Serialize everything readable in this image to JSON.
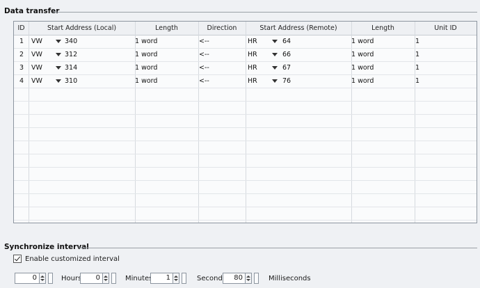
{
  "data_transfer": {
    "title": "Data transfer",
    "columns": [
      "ID",
      "Start Address (Local)",
      "Length",
      "Direction",
      "Start Address (Remote)",
      "Length",
      "Unit ID"
    ],
    "rows": [
      {
        "id": "1",
        "local_area": "VW",
        "local_addr": "340",
        "local_len": "1 word",
        "direction": "<--",
        "remote_area": "HR",
        "remote_addr": "64",
        "remote_len": "1 word",
        "unit_id": "1"
      },
      {
        "id": "2",
        "local_area": "VW",
        "local_addr": "312",
        "local_len": "1 word",
        "direction": "<--",
        "remote_area": "HR",
        "remote_addr": "66",
        "remote_len": "1 word",
        "unit_id": "1"
      },
      {
        "id": "3",
        "local_area": "VW",
        "local_addr": "314",
        "local_len": "1 word",
        "direction": "<--",
        "remote_area": "HR",
        "remote_addr": "67",
        "remote_len": "1 word",
        "unit_id": "1"
      },
      {
        "id": "4",
        "local_area": "VW",
        "local_addr": "310",
        "local_len": "1 word",
        "direction": "<--",
        "remote_area": "HR",
        "remote_addr": "76",
        "remote_len": "1 word",
        "unit_id": "1"
      }
    ]
  },
  "sync": {
    "title": "Synchronize interval",
    "enable_label": "Enable customized interval",
    "enable_checked": true,
    "hours_value": "0",
    "hours_label": "Hours",
    "minutes_value": "0",
    "minutes_label": "Minutes",
    "seconds_value": "1",
    "seconds_label": "Seconds",
    "ms_value": "80",
    "ms_label": "Milliseconds"
  }
}
